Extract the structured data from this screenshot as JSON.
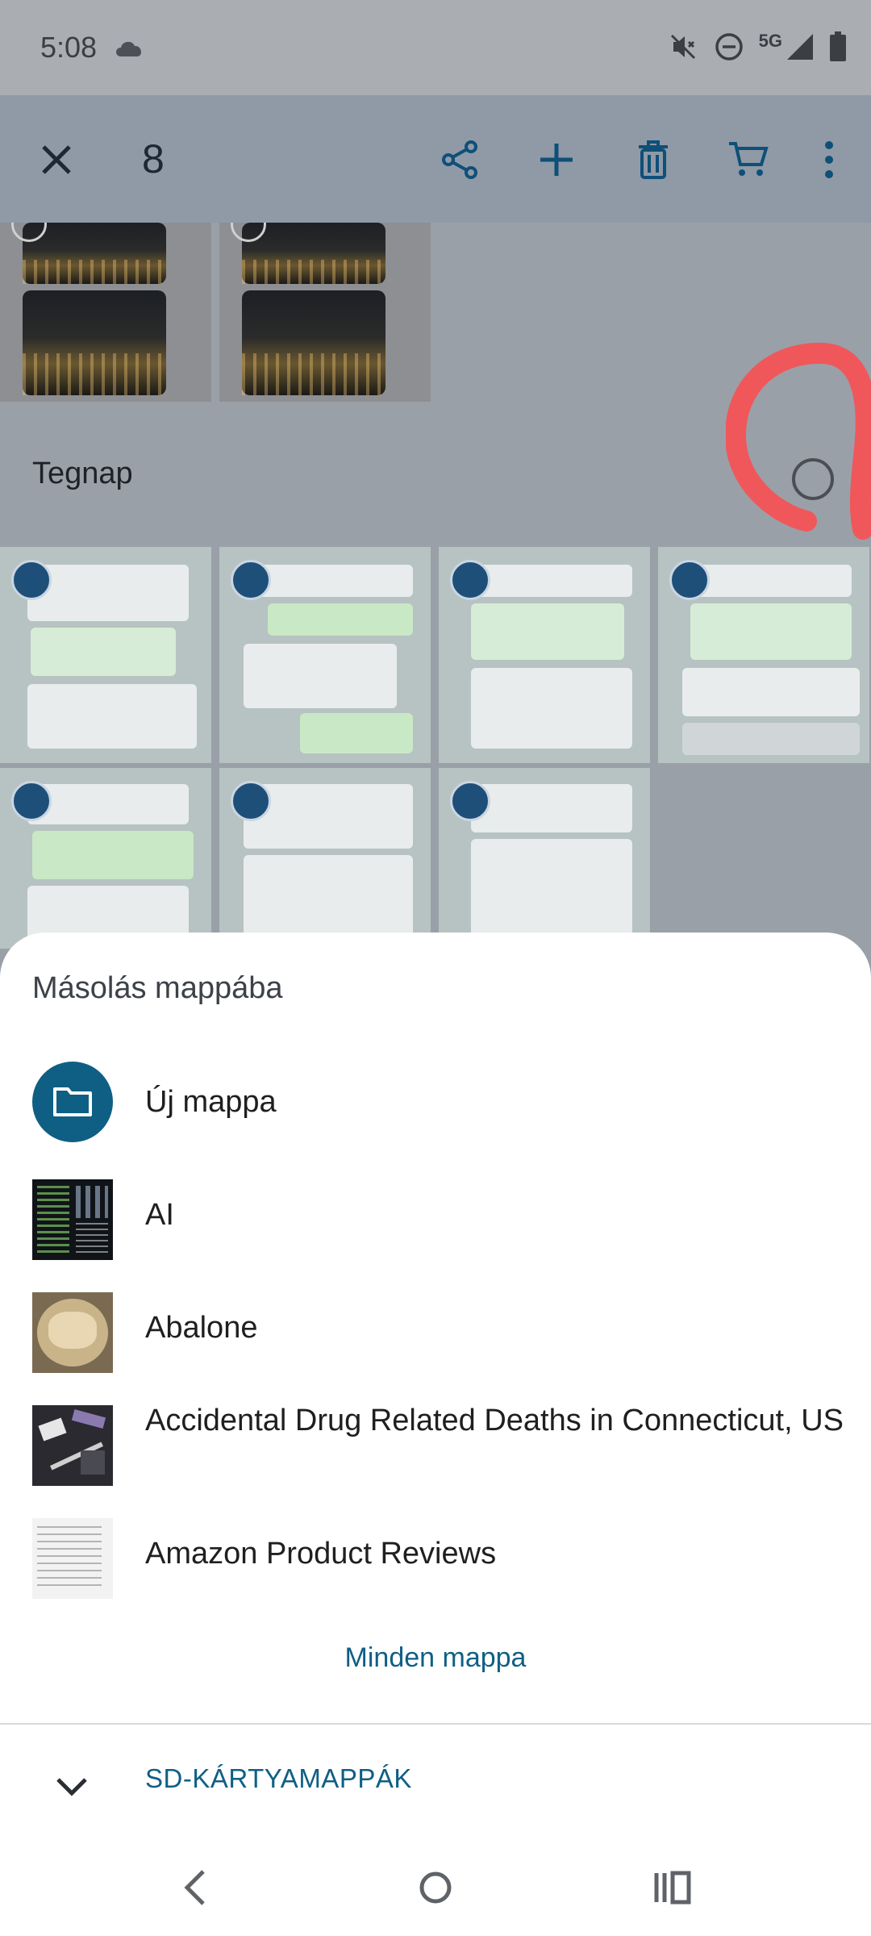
{
  "status_bar": {
    "time": "5:08",
    "network": "5G"
  },
  "toolbar": {
    "selected_count": "8"
  },
  "gallery": {
    "section_title": "Tegnap"
  },
  "sheet": {
    "title": "Másolás mappába",
    "folders": [
      {
        "name": "Új mappa",
        "icon": "folder-icon"
      },
      {
        "name": "AI"
      },
      {
        "name": "Abalone"
      },
      {
        "name": "Accidental Drug Related Deaths in Connecticut, US"
      },
      {
        "name": "Amazon Product Reviews"
      }
    ],
    "all_folders_link": "Minden mappa",
    "sd_section_label": "SD-KÁRTYAMAPPÁK"
  },
  "colors": {
    "accent": "#0f5f85",
    "check": "#1e4f79",
    "scribble": "#f0575a"
  }
}
